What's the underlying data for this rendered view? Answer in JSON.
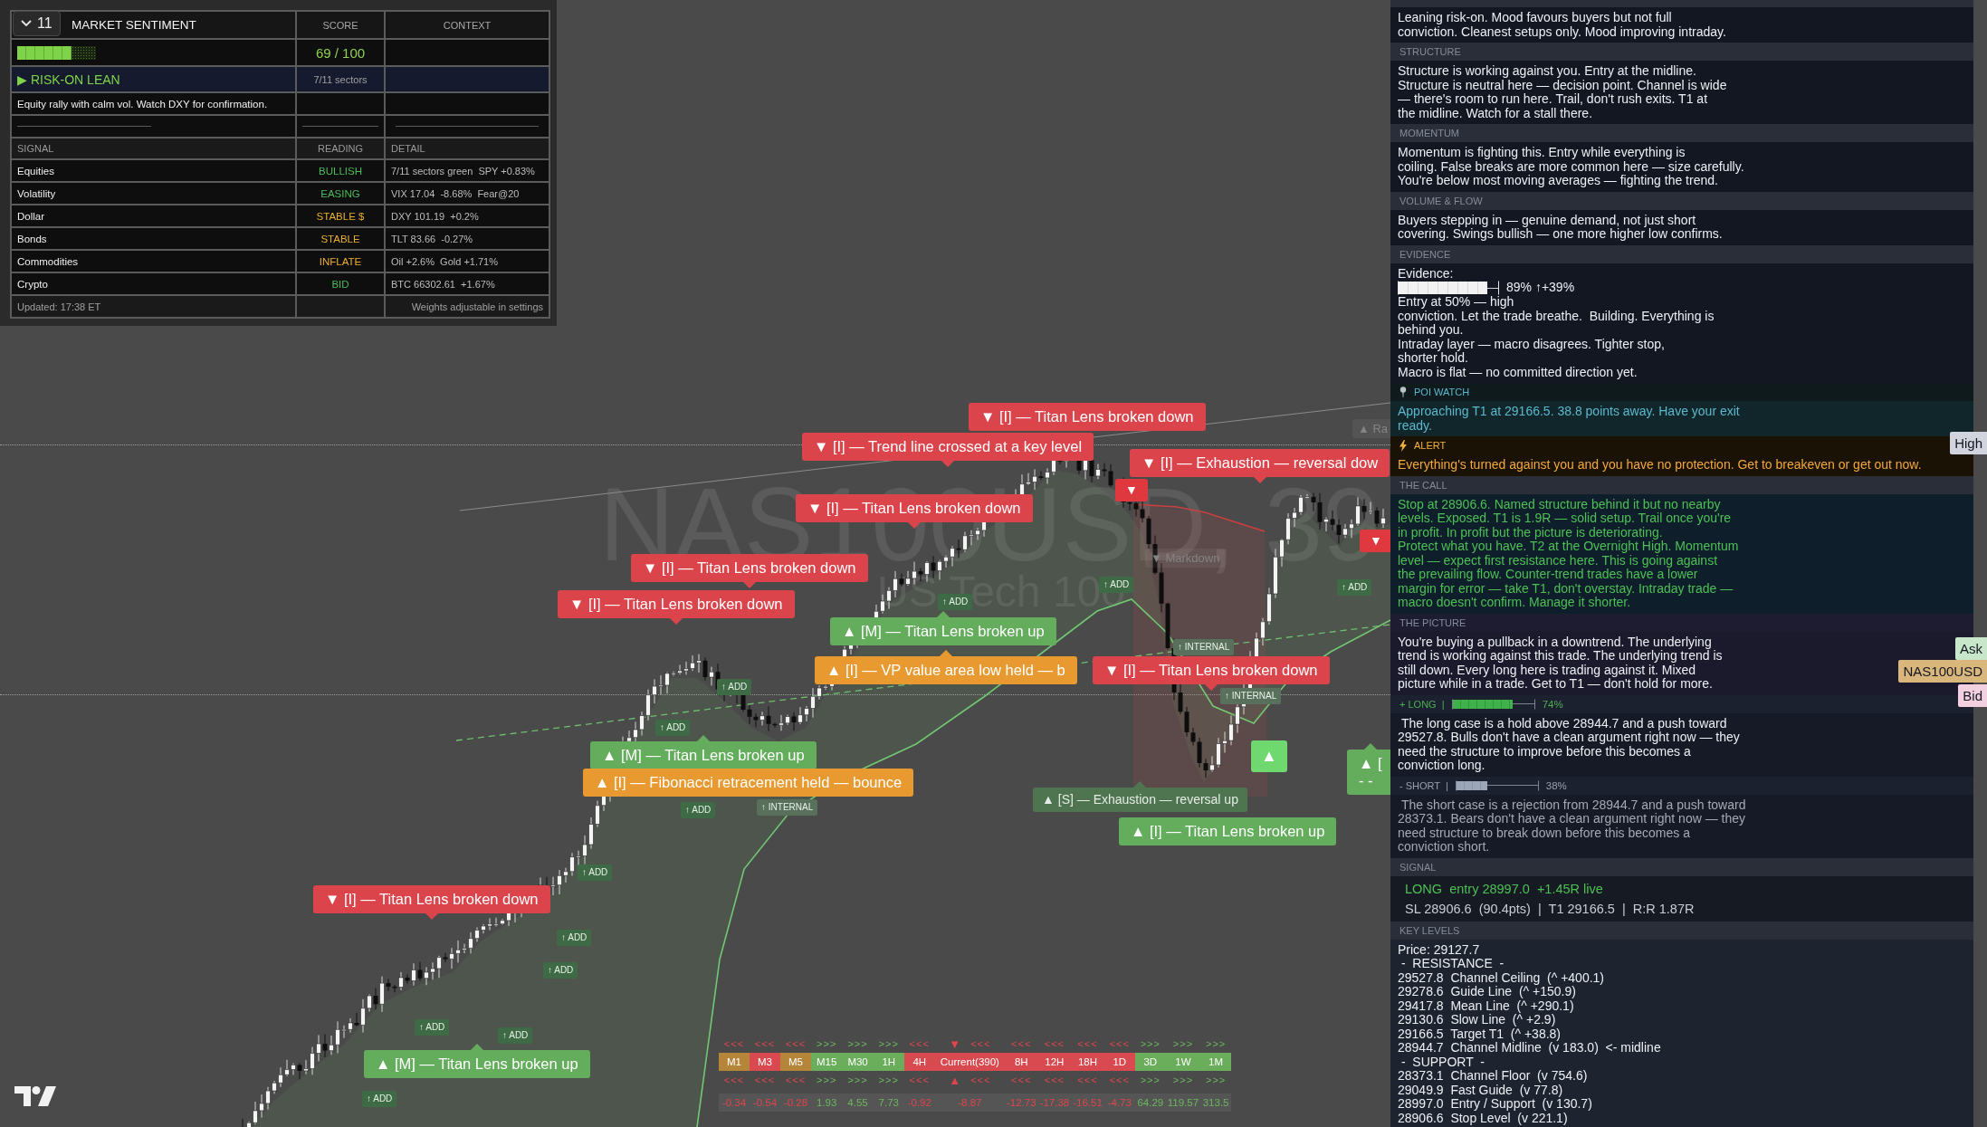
{
  "sentiment": {
    "collapse_count": "11",
    "title": "MARKET SENTIMENT",
    "score_heading": "SCORE",
    "context_heading": "CONTEXT",
    "gauge": {
      "level": 0.69
    },
    "score": "69 / 100",
    "bias": "▶ RISK-ON LEAN",
    "sectors": "7/11 sectors",
    "summary": "Equity rally with calm vol. Watch DXY for confirmation.",
    "columns": [
      "SIGNAL",
      "READING",
      "DETAIL"
    ],
    "signals": [
      {
        "name": "Equities",
        "reading": "BULLISH",
        "positive": true,
        "detail": "7/11 sectors green  SPY +0.83%"
      },
      {
        "name": "Volatility",
        "reading": "EASING",
        "positive": true,
        "detail": "VIX 17.04  -8.68%  Fear@20"
      },
      {
        "name": "Dollar",
        "reading": "STABLE $",
        "positive": false,
        "detail": "DXY 101.19  +0.2%"
      },
      {
        "name": "Bonds",
        "reading": "STABLE",
        "positive": false,
        "detail": "TLT 83.66  -0.27%"
      },
      {
        "name": "Commodities",
        "reading": "INFLATE",
        "positive": false,
        "detail": "Oil +2.6%  Gold +1.71%"
      },
      {
        "name": "Crypto",
        "reading": "BID",
        "positive": true,
        "detail": "BTC 66302.61  +1.67%"
      }
    ],
    "updated": "Updated: 17:38 ET",
    "footnote": "Weights adjustable in settings"
  },
  "chart": {
    "symbol": "NAS100USD, 39",
    "description": "US Tech 100",
    "labels": [
      {
        "kind": "sell",
        "text": "▼ [I] — Titan Lens broken down"
      },
      {
        "kind": "faint",
        "text": "▲ Ra"
      },
      {
        "kind": "sell",
        "text": "▼ [I] — Trend line crossed at a key level"
      },
      {
        "kind": "sell",
        "text": "▼ [I] — Exhaustion — reversal dow"
      },
      {
        "kind": "marker-sell",
        "text": "▼"
      },
      {
        "kind": "sell",
        "text": "▼ [I] — Titan Lens broken down"
      },
      {
        "kind": "marker-sell",
        "text": "▼"
      },
      {
        "kind": "faint",
        "text": "▼ Markdown"
      },
      {
        "kind": "sell",
        "text": "▼ [I] — Titan Lens broken down"
      },
      {
        "kind": "sell",
        "text": "▼ [I] — Titan Lens broken down"
      },
      {
        "kind": "buy",
        "text": "▲ [M] — Titan Lens broken up"
      },
      {
        "kind": "level",
        "text": "▲ [I] — VP value area low held — b"
      },
      {
        "kind": "sell",
        "text": "▼ [I] — Titan Lens broken down"
      },
      {
        "kind": "buy",
        "text": "▲ [M] — Titan Lens broken up"
      },
      {
        "kind": "marker-buy",
        "text": "▲"
      },
      {
        "kind": "buy",
        "text": "▲ [\n- -"
      },
      {
        "kind": "level",
        "text": "▲ [I] — Fibonacci retracement held — bounce"
      },
      {
        "kind": "scalp",
        "text": "▲ [S] — Exhaustion — reversal up"
      },
      {
        "kind": "buy",
        "text": "▲ [I] — Titan Lens broken up"
      },
      {
        "kind": "sell",
        "text": "▼ [I] — Titan Lens broken down"
      },
      {
        "kind": "buy",
        "text": "▲ [M] — Titan Lens broken up"
      }
    ],
    "tags": [
      {
        "kind": "add",
        "text": "↑ ADD"
      },
      {
        "kind": "add",
        "text": "↑ ADD"
      },
      {
        "kind": "add",
        "text": "↑ ADD"
      },
      {
        "kind": "internal",
        "text": "↑ INTERNAL"
      },
      {
        "kind": "add",
        "text": "↑ ADD"
      },
      {
        "kind": "internal",
        "text": "↑ INTERNAL"
      },
      {
        "kind": "add",
        "text": "↑ ADD"
      },
      {
        "kind": "internal",
        "text": "↑ INTERNAL"
      },
      {
        "kind": "add",
        "text": "↑ ADD"
      },
      {
        "kind": "add",
        "text": "↑ ADD"
      },
      {
        "kind": "add",
        "text": "↑ ADD"
      },
      {
        "kind": "add",
        "text": "↑ ADD"
      },
      {
        "kind": "add",
        "text": "↑ ADD"
      },
      {
        "kind": "add",
        "text": "↑ ADD"
      },
      {
        "kind": "add",
        "text": "↑ ADD"
      }
    ]
  },
  "timeframes": [
    {
      "label": "M1",
      "color": "#b5853a",
      "bullish": false,
      "arrows_top": "<<<",
      "arrows_bottom": "<<<",
      "value": "-0.34"
    },
    {
      "label": "M3",
      "color": "#d94a50",
      "bullish": false,
      "arrows_top": "<<<",
      "arrows_bottom": "<<<",
      "value": "-0.54"
    },
    {
      "label": "M5",
      "color": "#b5853a",
      "bullish": false,
      "arrows_top": "<<<",
      "arrows_bottom": "<<<",
      "value": "-0.28"
    },
    {
      "label": "M15",
      "color": "#6aad5a",
      "bullish": true,
      "arrows_top": ">>>",
      "arrows_bottom": ">>>",
      "value": "1.93"
    },
    {
      "label": "M30",
      "color": "#6aad5a",
      "bullish": true,
      "arrows_top": ">>>",
      "arrows_bottom": ">>>",
      "value": "4.55"
    },
    {
      "label": "1H",
      "color": "#6aad5a",
      "bullish": true,
      "arrows_top": ">>>",
      "arrows_bottom": ">>>",
      "value": "7.73"
    },
    {
      "label": "4H",
      "color": "#d94a50",
      "bullish": false,
      "arrows_top": "<<<",
      "arrows_bottom": "<<<",
      "value": "-0.92"
    },
    {
      "label": "Current(390)",
      "color": "#d94a50",
      "bullish": false,
      "marker_top": "▼",
      "arrows_top": "<<<",
      "marker_bottom": "▲",
      "arrows_bottom": "<<<",
      "value": "-8.87"
    },
    {
      "label": "8H",
      "color": "#d94a50",
      "bullish": false,
      "arrows_top": "<<<",
      "arrows_bottom": "<<<",
      "value": "-12.73"
    },
    {
      "label": "12H",
      "color": "#d94a50",
      "bullish": false,
      "arrows_top": "<<<",
      "arrows_bottom": "<<<",
      "value": "-17.38"
    },
    {
      "label": "18H",
      "color": "#d94a50",
      "bullish": false,
      "arrows_top": "<<<",
      "arrows_bottom": "<<<",
      "value": "-16.51"
    },
    {
      "label": "1D",
      "color": "#d94a50",
      "bullish": false,
      "arrows_top": "<<<",
      "arrows_bottom": "<<<",
      "value": "-4.73"
    },
    {
      "label": "3D",
      "color": "#6aad5a",
      "bullish": true,
      "arrows_top": ">>>",
      "arrows_bottom": ">>>",
      "value": "64.29"
    },
    {
      "label": "1W",
      "color": "#6aad5a",
      "bullish": true,
      "arrows_top": ">>>",
      "arrows_bottom": ">>>",
      "value": "119.57"
    },
    {
      "label": "1M",
      "color": "#6aad5a",
      "bullish": true,
      "arrows_top": ">>>",
      "arrows_bottom": ">>>",
      "value": "313.5"
    }
  ],
  "panel": {
    "sections": [
      {
        "kind": "note",
        "text": "Leaning risk-on. Mood favours buyers but not full\nconviction. Cleanest setups only. Mood improving intraday."
      },
      {
        "kind": "note",
        "heading": "STRUCTURE",
        "text": "Structure is working against you. Entry at the midline.\nStructure is neutral here — decision point. Channel is wide\n— there's room to run here. Trail, don't rush exits. T1 at\nthe midline. Watch for a stall there."
      },
      {
        "kind": "note",
        "heading": "MOMENTUM",
        "text": "Momentum is fighting this. Entry while everything is\ncoiling. False breaks are more common here — size carefully.\nYou're below most moving averages — fighting the trend."
      },
      {
        "kind": "note",
        "heading": "VOLUME & FLOW",
        "text": "Buyers stepping in — genuine demand, not just short\ncovering. Swings bullish — one more higher low confirms."
      },
      {
        "kind": "evidence",
        "heading": "EVIDENCE",
        "label": "Evidence:",
        "meter": {
          "level": 0.89,
          "reading": "89% ↑+39%"
        },
        "text": "Entry at 50% — high\nconviction. Let the trade breathe.  Building. Everything is\nbehind you.\nIntraday layer — macro disagrees. Tighter stop,\nshorter hold.\nMacro is flat — no committed direction yet."
      },
      {
        "kind": "poi",
        "heading": "POI WATCH",
        "text": "Approaching T1 at 29166.5. 38.8 points away. Have your exit\nready."
      },
      {
        "kind": "alert",
        "heading": "ALERT",
        "text": "Everything's turned against you and you have no protection. Get to breakeven or get out now."
      },
      {
        "kind": "call",
        "heading": "THE CALL",
        "text": "Stop at 28906.6. Named structure behind it but no nearby\nlevels. Exposed. T1 is 1.9R — solid setup. Trail once you're\nin profit. In profit but the picture is deteriorating.\nProtect what you have. T2 at the Overnight High. Momentum\nlevel — expect first resistance here. This is going against\nthe prevailing flow. Counter-trend trades have a lower\nmargin for error — take T1, don't overstay. Intraday trade —\nmacro doesn't confirm. Manage it shorter."
      },
      {
        "kind": "picture",
        "heading": "THE PICTURE",
        "text": "You're buying a pullback in a downtrend. The underlying\ntrend is working against this trade. The underlying trend is\nstill down. Every long here is trading against it. Mixed\npicture while in a trade. Get to T1 — don't hold for more."
      },
      {
        "kind": "long",
        "heading": "+ LONG  |",
        "meter": {
          "level": 0.74,
          "reading": "74%"
        },
        "text": " The long case is a hold above 28944.7 and a push toward\n29527.8. Bulls don't have a clean argument right now — they\nneed the structure to improve before this becomes a\nconviction long."
      },
      {
        "kind": "short",
        "heading": "- SHORT  |",
        "meter": {
          "level": 0.38,
          "reading": "38%"
        },
        "text": " The short case is a rejection from 28944.7 and a push toward\n28373.1. Bears don't have a clean argument right now — they\nneed structure to break down before this becomes a\nconviction short."
      },
      {
        "kind": "signal",
        "heading": "SIGNAL",
        "lines": [
          "LONG  entry 28997.0  +1.45R live",
          "SL 28906.6  (90.4pts)  |  T1 29166.5  |  R:R 1.87R"
        ]
      },
      {
        "kind": "levels",
        "heading": "KEY LEVELS",
        "text": "Price: 29127.7\n -  RESISTANCE  -\n29527.8  Channel Ceiling  (^ +400.1)\n29278.6  Guide Line  (^ +150.9)\n29417.8  Mean Line  (^ +290.1)\n29130.6  Slow Line  (^ +2.9)\n29166.5  Target T1  (^ +38.8)\n28944.7  Channel Midline  (v 183.0)  <- midline\n -  SUPPORT  -\n28373.1  Channel Floor  (v 754.6)\n29049.9  Fast Guide  (v 77.8)\n28997.0  Entry / Support  (v 130.7)\n28906.6  Stop Level  (v 221.1)"
      }
    ]
  },
  "price_tags": [
    {
      "label": "High",
      "color": "#d1d4dc"
    },
    {
      "label": "Ask",
      "color": "#c8e6c9"
    },
    {
      "label": "NAS100USD",
      "color": "#d8b67c"
    },
    {
      "label": "Bid",
      "color": "#f3d0e0"
    }
  ]
}
